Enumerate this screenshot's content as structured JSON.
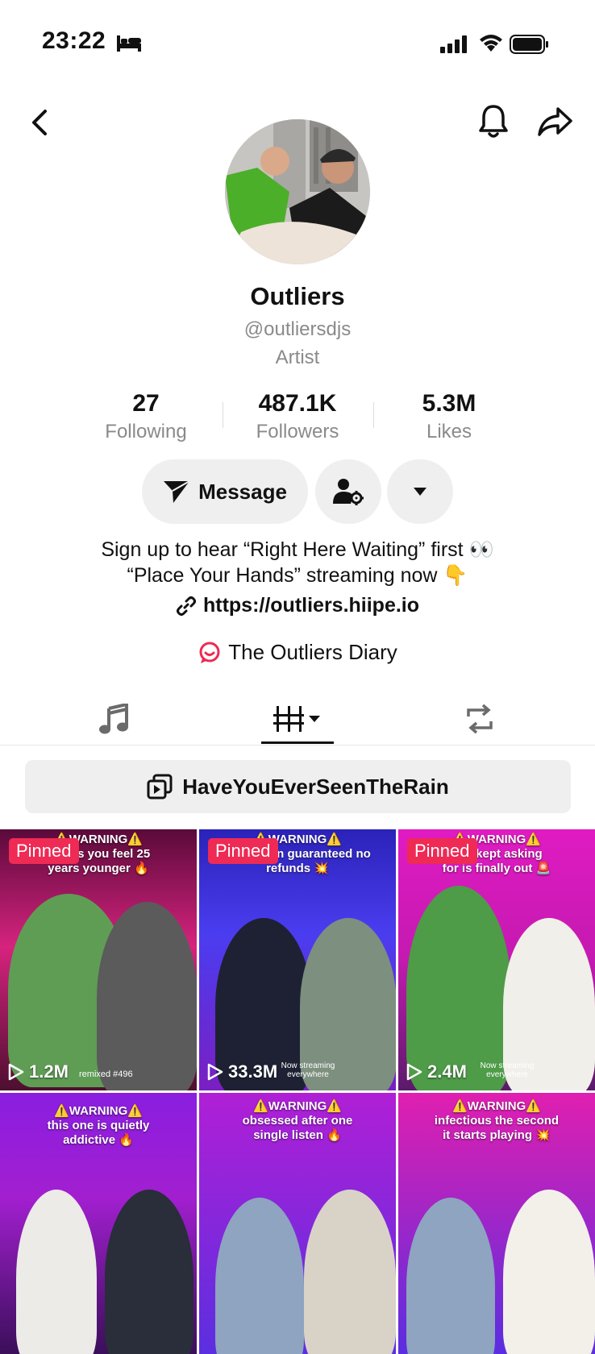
{
  "status_bar": {
    "time": "23:22"
  },
  "profile": {
    "name": "Outliers",
    "handle": "@outliersdjs",
    "category": "Artist"
  },
  "stats": [
    {
      "value": "27",
      "label": "Following"
    },
    {
      "value": "487.1K",
      "label": "Followers"
    },
    {
      "value": "5.3M",
      "label": "Likes"
    }
  ],
  "actions": {
    "message_label": "Message"
  },
  "bio": {
    "line1": "Sign up to hear “Right Here Waiting” first 👀",
    "line2": "“Place Your Hands” streaming now 👇",
    "link": "https://outliers.hiipe.io"
  },
  "diary": {
    "label": "The Outliers Diary"
  },
  "playlist": {
    "label": "HaveYouEverSeenTheRain"
  },
  "videos": [
    {
      "pinned": "Pinned",
      "caption_lines": [
        "⚠️WARNING⚠️",
        "makes you feel 25",
        "years younger 🔥"
      ],
      "views": "1.2M",
      "overlay": "remixed #496",
      "bg": "#c2186a"
    },
    {
      "pinned": "Pinned",
      "caption_lines": [
        "⚠️WARNING⚠️",
        "obsession guaranteed no",
        "refunds 💥"
      ],
      "views": "33.3M",
      "overlay": "Now streaming everywhere",
      "bg": "#3a2fd0"
    },
    {
      "pinned": "Pinned",
      "caption_lines": [
        "⚠️WARNING⚠️",
        "you kept asking",
        "for is finally out 🚨"
      ],
      "views": "2.4M",
      "overlay": "Now streaming everywhere",
      "bg": "#d41bb8"
    },
    {
      "pinned": "",
      "caption_lines": [
        "⚠️WARNING⚠️",
        "this one is quietly",
        "addictive 🔥"
      ],
      "views": "",
      "overlay": "",
      "bg": "#9a1fd6"
    },
    {
      "pinned": "",
      "caption_lines": [
        "⚠️WARNING⚠️",
        "obsessed after one",
        "single listen 🔥"
      ],
      "views": "",
      "overlay": "",
      "bg": "#b21fd8"
    },
    {
      "pinned": "",
      "caption_lines": [
        "⚠️WARNING⚠️",
        "infectious the second",
        "it starts playing 💥"
      ],
      "views": "",
      "overlay": "",
      "bg": "#4a2ee0"
    }
  ],
  "colors": {
    "pinned_badge": "#ee2a55",
    "button_bg": "#efefef",
    "secondary_text": "#8a8a8a",
    "diary_icon": "#ee2a55"
  }
}
